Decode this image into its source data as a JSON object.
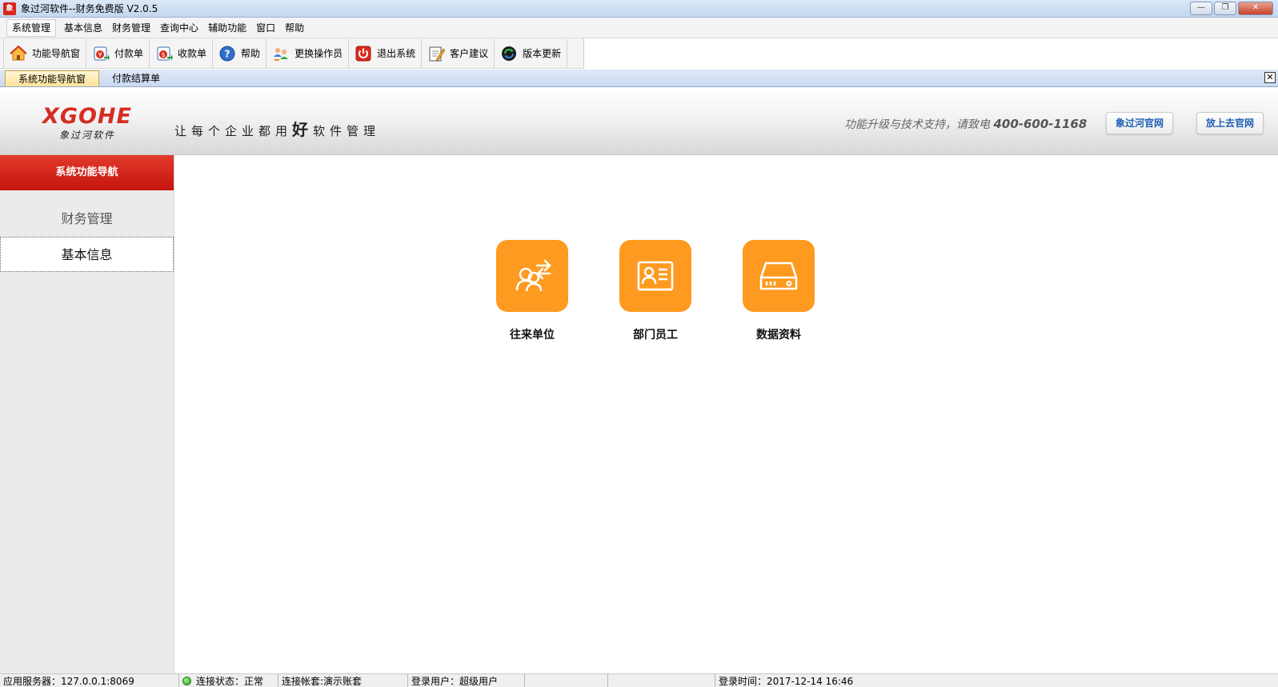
{
  "window": {
    "title": "象过河软件--财务免费版 V2.0.5",
    "app_icon_text": "象",
    "minimize": "—",
    "restore": "❐",
    "close": "✕"
  },
  "menubar": {
    "items": [
      "系统管理",
      "基本信息",
      "财务管理",
      "查询中心",
      "辅助功能",
      "窗口",
      "帮助"
    ]
  },
  "toolbar": {
    "items": [
      {
        "label": "功能导航窗",
        "icon": "home-icon"
      },
      {
        "label": "付款单",
        "icon": "payment-icon"
      },
      {
        "label": "收款单",
        "icon": "receipt-icon"
      },
      {
        "label": "帮助",
        "icon": "help-icon"
      },
      {
        "label": "更换操作员",
        "icon": "switch-user-icon"
      },
      {
        "label": "退出系统",
        "icon": "exit-icon"
      },
      {
        "label": "客户建议",
        "icon": "suggestion-icon"
      },
      {
        "label": "版本更新",
        "icon": "update-icon"
      }
    ]
  },
  "tabs": {
    "items": [
      "系统功能导航窗",
      "付款结算单"
    ],
    "active": 0,
    "close_label": "✕"
  },
  "banner": {
    "logo_main": "XGOHE",
    "logo_sub": "象过河软件",
    "slogan_pre": "让每个企业都用",
    "slogan_big": "好",
    "slogan_post": "软件管理",
    "support_text": "功能升级与技术支持，请致电",
    "support_phone": "400-600-1168",
    "official_site_button": "象过河官网",
    "cloud_site_button": "放上去官网"
  },
  "sidebar": {
    "header": "系统功能导航",
    "items": [
      "财务管理",
      "基本信息"
    ],
    "active": 1
  },
  "main": {
    "tiles": [
      {
        "label": "往来单位",
        "icon": "contacts-exchange-icon"
      },
      {
        "label": "部门员工",
        "icon": "employee-card-icon"
      },
      {
        "label": "数据资料",
        "icon": "data-storage-icon"
      }
    ]
  },
  "statusbar": {
    "server": "应用服务器：127.0.0.1:8069",
    "connection_status": "连接状态：正常",
    "account_set": "连接帐套:演示账套",
    "login_user": "登录用户：超级用户",
    "empty1": "",
    "empty2": "",
    "login_time": "登录时间：2017-12-14 16:46"
  },
  "colors": {
    "brand_red": "#d52c22",
    "tile_orange": "#fe9a1f",
    "link_blue": "#1f5fb5",
    "status_green": "#2a9a1a"
  }
}
